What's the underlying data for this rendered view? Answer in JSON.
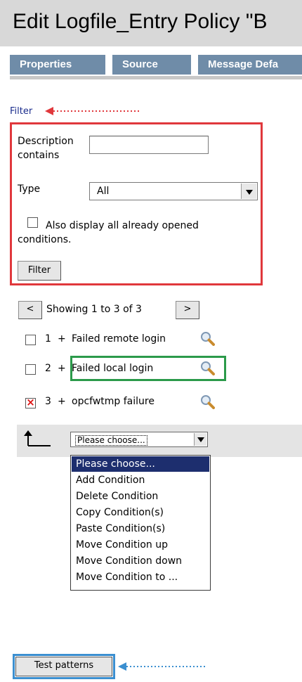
{
  "window": {
    "title": "Edit Logfile_Entry Policy \"B"
  },
  "tabs": [
    {
      "label": "Properties"
    },
    {
      "label": "Source"
    },
    {
      "label": "Message Defa"
    }
  ],
  "filter": {
    "link_label": "Filter",
    "description_label_line1": "Description",
    "description_label_line2": "contains",
    "description_value": "",
    "type_label": "Type",
    "type_value": "All",
    "also_display_line1": "Also display all already opened",
    "also_display_line2": "conditions.",
    "also_display_checked": false,
    "filter_button_label": "Filter"
  },
  "pager": {
    "prev_label": "<",
    "status_text": "Showing 1 to 3 of 3",
    "next_label": ">"
  },
  "conditions": [
    {
      "number": "1",
      "toggle": "+",
      "name": "Failed remote login",
      "checked": false
    },
    {
      "number": "2",
      "toggle": "+",
      "name": "Failed local login",
      "checked": false
    },
    {
      "number": "3",
      "toggle": "+",
      "name": "opcfwtmp failure",
      "checked": true
    }
  ],
  "action": {
    "selected": "Please choose...",
    "options": [
      "Please choose...",
      "Add Condition",
      "Delete Condition",
      "Copy Condition(s)",
      "Paste Condition(s)",
      "Move Condition up",
      "Move Condition down",
      "Move Condition to ..."
    ]
  },
  "test_patterns_label": "Test patterns",
  "colors": {
    "tab_bg": "#6f8ca8",
    "filter_highlight": "#e0383c",
    "row_highlight": "#2b9a4a",
    "button_highlight": "#3b8fd0",
    "selected_option_bg": "#1d2e6e"
  }
}
